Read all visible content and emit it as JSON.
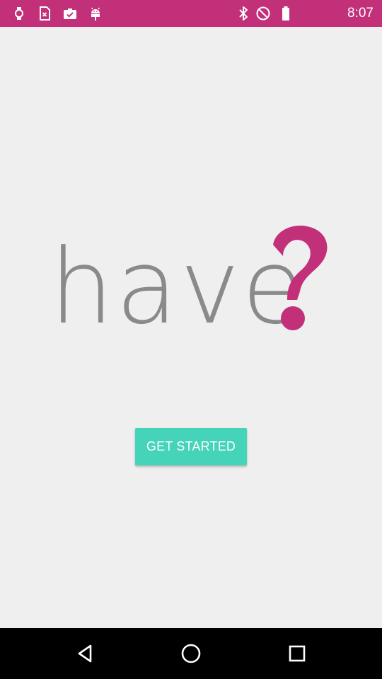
{
  "status_bar": {
    "background": "#c2307a",
    "time": "8:07",
    "left_icons": [
      "watch-icon",
      "sim-error-icon",
      "briefcase-check-icon",
      "android-icon"
    ],
    "right_icons": [
      "bluetooth-icon",
      "do-not-disturb-icon",
      "battery-icon"
    ]
  },
  "logo": {
    "word": "have",
    "mark": "?",
    "word_color": "#8a8a8a",
    "mark_color": "#c2307a"
  },
  "main": {
    "get_started_label": "GET STARTED",
    "button_color": "#45d3b9"
  },
  "nav_bar": {
    "icons": [
      "back-icon",
      "home-icon",
      "recents-icon"
    ]
  }
}
